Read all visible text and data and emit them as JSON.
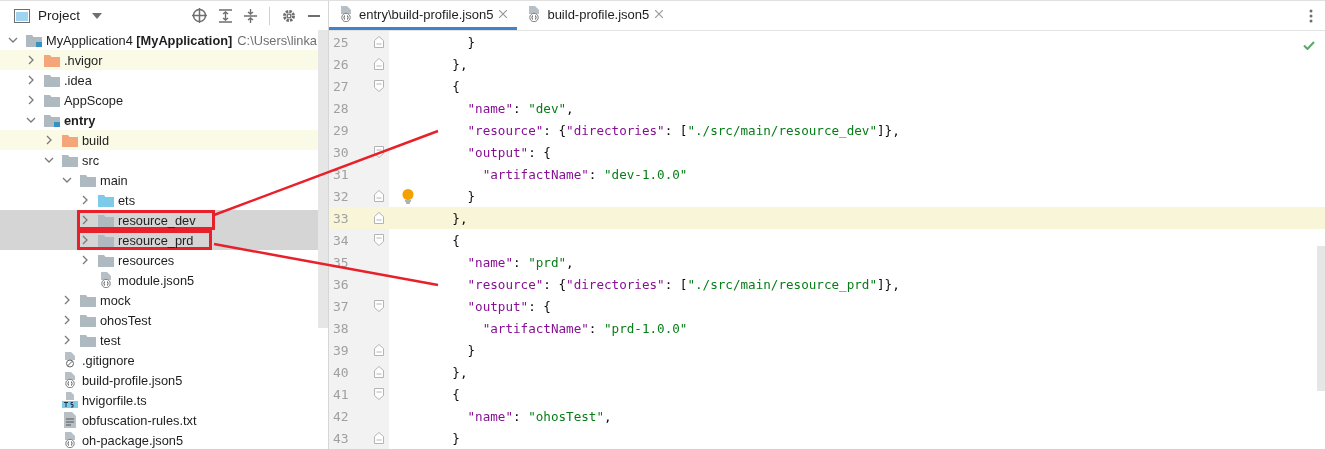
{
  "project_panel": {
    "title": "Project",
    "tree": [
      {
        "label": "MyApplication4 **[MyApplication]**",
        "path": "C:\\Users\\linka",
        "kind": "module",
        "expanded": true,
        "excluded": false,
        "selected": false,
        "callout": false,
        "children": [
          {
            "label": ".hvigor",
            "kind": "folder",
            "expanded": false,
            "excluded": true,
            "selected": false,
            "callout": false
          },
          {
            "label": ".idea",
            "kind": "folder",
            "expanded": false,
            "excluded": false,
            "selected": false,
            "callout": false
          },
          {
            "label": "AppScope",
            "kind": "folder",
            "expanded": false,
            "excluded": false,
            "selected": false,
            "callout": false
          },
          {
            "label": "entry",
            "kind": "module",
            "bold": true,
            "expanded": true,
            "excluded": false,
            "selected": false,
            "callout": false,
            "children": [
              {
                "label": "build",
                "kind": "folder",
                "expanded": false,
                "excluded": true,
                "selected": false,
                "callout": false
              },
              {
                "label": "src",
                "kind": "folder",
                "expanded": true,
                "excluded": false,
                "selected": false,
                "callout": false,
                "children": [
                  {
                    "label": "main",
                    "kind": "folder",
                    "expanded": true,
                    "excluded": false,
                    "selected": false,
                    "callout": false,
                    "children": [
                      {
                        "label": "ets",
                        "kind": "source",
                        "expanded": false,
                        "excluded": false,
                        "selected": false,
                        "callout": false
                      },
                      {
                        "label": "resource_dev",
                        "kind": "folder",
                        "expanded": false,
                        "excluded": false,
                        "selected": true,
                        "callout": true
                      },
                      {
                        "label": "resource_prd",
                        "kind": "folder",
                        "expanded": false,
                        "excluded": false,
                        "selected": true,
                        "callout": true
                      },
                      {
                        "label": "resources",
                        "kind": "folder",
                        "expanded": false,
                        "excluded": false,
                        "selected": false,
                        "callout": false
                      },
                      {
                        "label": "module.json5",
                        "kind": "json",
                        "excluded": false,
                        "selected": false,
                        "callout": false
                      }
                    ]
                  },
                  {
                    "label": "mock",
                    "kind": "folder",
                    "expanded": false,
                    "excluded": false,
                    "selected": false,
                    "callout": false
                  },
                  {
                    "label": "ohosTest",
                    "kind": "folder",
                    "expanded": false,
                    "excluded": false,
                    "selected": false,
                    "callout": false
                  },
                  {
                    "label": "test",
                    "kind": "folder",
                    "expanded": false,
                    "excluded": false,
                    "selected": false,
                    "callout": false
                  }
                ]
              },
              {
                "label": ".gitignore",
                "kind": "ignore",
                "excluded": false,
                "selected": false,
                "callout": false
              },
              {
                "label": "build-profile.json5",
                "kind": "json",
                "excluded": false,
                "selected": false,
                "callout": false
              },
              {
                "label": "hvigorfile.ts",
                "kind": "ts",
                "excluded": false,
                "selected": false,
                "callout": false
              },
              {
                "label": "obfuscation-rules.txt",
                "kind": "text",
                "excluded": false,
                "selected": false,
                "callout": false
              },
              {
                "label": "oh-package.json5",
                "kind": "json",
                "excluded": false,
                "selected": false,
                "callout": false
              }
            ]
          }
        ]
      }
    ]
  },
  "editor": {
    "tabs": [
      {
        "label": "entry\\build-profile.json5",
        "selected": true
      },
      {
        "label": "build-profile.json5",
        "selected": false
      }
    ],
    "lines": [
      {
        "number": "25",
        "fold_open": false,
        "fold_close": true,
        "current": false,
        "bulb": false,
        "tokens": [
          {
            "kind": "punct",
            "text": "      }"
          }
        ]
      },
      {
        "number": "26",
        "fold_open": false,
        "fold_close": true,
        "current": false,
        "bulb": false,
        "tokens": [
          {
            "kind": "punct",
            "text": "    },"
          }
        ]
      },
      {
        "number": "27",
        "fold_open": true,
        "fold_close": false,
        "current": false,
        "bulb": false,
        "tokens": [
          {
            "kind": "punct",
            "text": "    {"
          }
        ]
      },
      {
        "number": "28",
        "fold_open": false,
        "fold_close": false,
        "current": false,
        "bulb": false,
        "tokens": [
          {
            "kind": "key",
            "text": "      \"name\""
          },
          {
            "kind": "punct",
            "text": ": "
          },
          {
            "kind": "string",
            "text": "\"dev\""
          },
          {
            "kind": "punct",
            "text": ","
          }
        ]
      },
      {
        "number": "29",
        "fold_open": false,
        "fold_close": false,
        "current": false,
        "bulb": false,
        "tokens": [
          {
            "kind": "key",
            "text": "      \"resource\""
          },
          {
            "kind": "punct",
            "text": ": {"
          },
          {
            "kind": "key",
            "text": "\"directories\""
          },
          {
            "kind": "punct",
            "text": ": ["
          },
          {
            "kind": "string",
            "text": "\"./src/main/resource_dev\""
          },
          {
            "kind": "punct",
            "text": "]},"
          }
        ]
      },
      {
        "number": "30",
        "fold_open": true,
        "fold_close": false,
        "current": false,
        "bulb": false,
        "tokens": [
          {
            "kind": "key",
            "text": "      \"output\""
          },
          {
            "kind": "punct",
            "text": ": {"
          }
        ]
      },
      {
        "number": "31",
        "fold_open": false,
        "fold_close": false,
        "current": false,
        "bulb": false,
        "tokens": [
          {
            "kind": "key",
            "text": "        \"artifactName\""
          },
          {
            "kind": "punct",
            "text": ": "
          },
          {
            "kind": "string",
            "text": "\"dev-1.0.0\""
          }
        ]
      },
      {
        "number": "32",
        "fold_open": false,
        "fold_close": true,
        "current": false,
        "bulb": true,
        "tokens": [
          {
            "kind": "punct",
            "text": "      }"
          }
        ]
      },
      {
        "number": "33",
        "fold_open": false,
        "fold_close": true,
        "current": true,
        "bulb": false,
        "tokens": [
          {
            "kind": "punct",
            "text": "    },"
          }
        ]
      },
      {
        "number": "34",
        "fold_open": true,
        "fold_close": false,
        "current": false,
        "bulb": false,
        "tokens": [
          {
            "kind": "punct",
            "text": "    {"
          }
        ]
      },
      {
        "number": "35",
        "fold_open": false,
        "fold_close": false,
        "current": false,
        "bulb": false,
        "tokens": [
          {
            "kind": "key",
            "text": "      \"name\""
          },
          {
            "kind": "punct",
            "text": ": "
          },
          {
            "kind": "string",
            "text": "\"prd\""
          },
          {
            "kind": "punct",
            "text": ","
          }
        ]
      },
      {
        "number": "36",
        "fold_open": false,
        "fold_close": false,
        "current": false,
        "bulb": false,
        "tokens": [
          {
            "kind": "key",
            "text": "      \"resource\""
          },
          {
            "kind": "punct",
            "text": ": {"
          },
          {
            "kind": "key",
            "text": "\"directories\""
          },
          {
            "kind": "punct",
            "text": ": ["
          },
          {
            "kind": "string",
            "text": "\"./src/main/resource_prd\""
          },
          {
            "kind": "punct",
            "text": "]},"
          }
        ]
      },
      {
        "number": "37",
        "fold_open": true,
        "fold_close": false,
        "current": false,
        "bulb": false,
        "tokens": [
          {
            "kind": "key",
            "text": "      \"output\""
          },
          {
            "kind": "punct",
            "text": ": {"
          }
        ]
      },
      {
        "number": "38",
        "fold_open": false,
        "fold_close": false,
        "current": false,
        "bulb": false,
        "tokens": [
          {
            "kind": "key",
            "text": "        \"artifactName\""
          },
          {
            "kind": "punct",
            "text": ": "
          },
          {
            "kind": "string",
            "text": "\"prd-1.0.0\""
          }
        ]
      },
      {
        "number": "39",
        "fold_open": false,
        "fold_close": true,
        "current": false,
        "bulb": false,
        "tokens": [
          {
            "kind": "punct",
            "text": "      }"
          }
        ]
      },
      {
        "number": "40",
        "fold_open": false,
        "fold_close": true,
        "current": false,
        "bulb": false,
        "tokens": [
          {
            "kind": "punct",
            "text": "    },"
          }
        ]
      },
      {
        "number": "41",
        "fold_open": true,
        "fold_close": false,
        "current": false,
        "bulb": false,
        "tokens": [
          {
            "kind": "punct",
            "text": "    {"
          }
        ]
      },
      {
        "number": "42",
        "fold_open": false,
        "fold_close": false,
        "current": false,
        "bulb": false,
        "tokens": [
          {
            "kind": "key",
            "text": "      \"name\""
          },
          {
            "kind": "punct",
            "text": ": "
          },
          {
            "kind": "string",
            "text": "\"ohosTest\""
          },
          {
            "kind": "punct",
            "text": ","
          }
        ]
      },
      {
        "number": "43",
        "fold_open": false,
        "fold_close": true,
        "current": false,
        "bulb": false,
        "tokens": [
          {
            "kind": "punct",
            "text": "    }"
          }
        ]
      }
    ]
  }
}
